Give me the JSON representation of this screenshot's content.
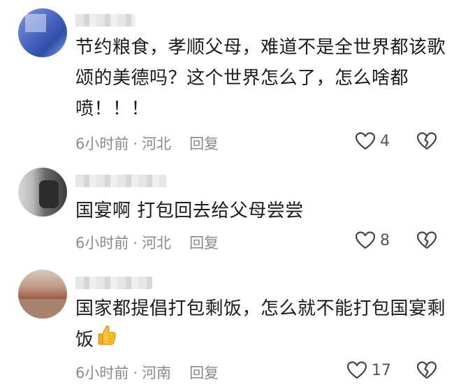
{
  "comments": [
    {
      "text": "节约粮食，孝顺父母，难道不是全世界都该歌颂的美德吗？这个世界怎么了，怎么啥都喷！！！",
      "time": "6小时前",
      "location": "河北",
      "reply_label": "回复",
      "likes": "4"
    },
    {
      "text": "国宴啊 打包回去给父母尝尝",
      "time": "6小时前",
      "location": "河北",
      "reply_label": "回复",
      "likes": "8"
    },
    {
      "text": "国家都提倡打包剩饭，怎么就不能打包国宴剩饭",
      "time": "6小时前",
      "location": "河南",
      "reply_label": "回复",
      "likes": "17",
      "emoji": "thumbs-up-icon"
    }
  ],
  "separator": "·",
  "colors": {
    "text": "#1b1b1b",
    "meta": "#8a8a8a",
    "icon": "#444444",
    "background": "#ffffff"
  }
}
